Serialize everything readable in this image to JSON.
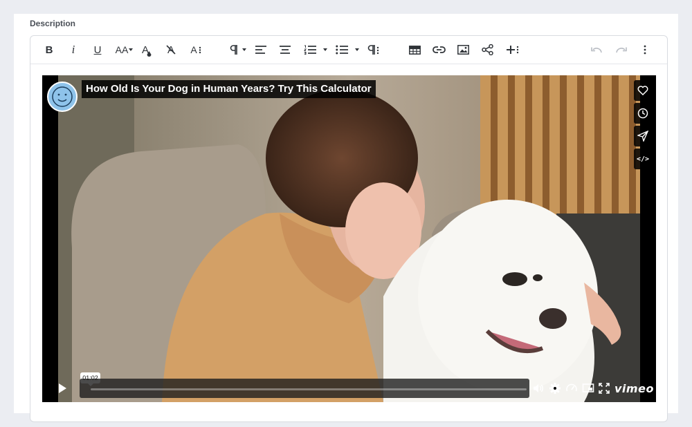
{
  "field": {
    "label": "Description"
  },
  "toolbar": {
    "bold": "B",
    "italic": "i",
    "underline": "U",
    "font_size": "AA",
    "text_color": "A",
    "clear_format": "A",
    "more_text": "A"
  },
  "video": {
    "title": "How Old Is Your Dog in Human Years? Try This Calculator",
    "current_time": "01:02",
    "progress": 0.0,
    "brand": "vimeo",
    "side_buttons": [
      "like-icon",
      "watch-later-icon",
      "share-icon",
      "embed-icon"
    ]
  },
  "colors": {
    "page_bg": "#ebedf2",
    "avatar": "#8ec3ea",
    "toolbar_icon": "#2f3338",
    "disabled_icon": "#b8bcc3"
  }
}
